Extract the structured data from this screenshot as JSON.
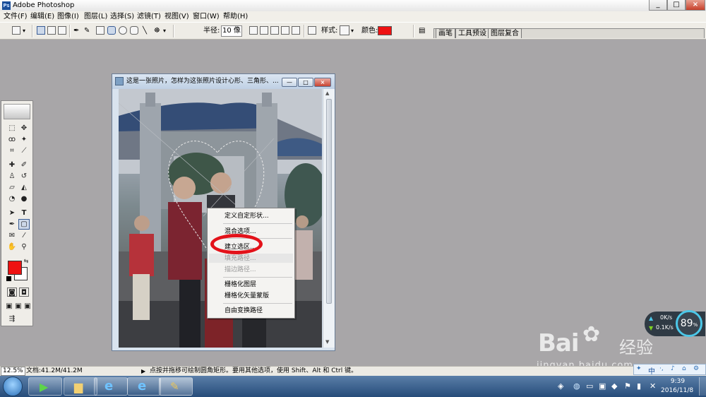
{
  "window": {
    "title": "Adobe Photoshop",
    "controls": [
      "_",
      "□",
      "×"
    ]
  },
  "menu": [
    "文件(F)",
    "编辑(E)",
    "图像(I)",
    "图层(L)",
    "选择(S)",
    "滤镜(T)",
    "视图(V)",
    "窗口(W)",
    "帮助(H)"
  ],
  "options_bar": {
    "radius_label": "半径:",
    "radius_value": "10 像",
    "style_label": "样式:",
    "color_label": "颜色:",
    "color_value": "#ee1111",
    "palette_tabs": [
      "画笔",
      "工具预设",
      "图层复合"
    ]
  },
  "document": {
    "title": "这是一张照片，怎样为这张照片设计心形、三角形、...",
    "controls": [
      "—",
      "□",
      "×"
    ]
  },
  "context_menu": {
    "items": [
      {
        "label": "定义自定形状...",
        "disabled": false
      },
      {
        "label": "混合选项...",
        "disabled": false
      },
      {
        "label": "建立选区...",
        "disabled": false
      },
      {
        "label": "填充路径...",
        "disabled": true
      },
      {
        "label": "描边路径...",
        "disabled": true
      },
      {
        "label": "栅格化图层",
        "disabled": false
      },
      {
        "label": "栅格化矢量蒙版",
        "disabled": false
      },
      {
        "label": "自由变换路径",
        "disabled": false
      }
    ]
  },
  "colors": {
    "foreground": "#ee1111",
    "background": "#ffffff",
    "highlight_ring": "#e3121a"
  },
  "status_bar": {
    "zoom": "12.5%",
    "doc_size": "文档:41.2M/41.2M",
    "hint": "点按并拖移可绘制圆角矩形。要用其他选项，使用 Shift、Alt 和 Ctrl 键。"
  },
  "net_widget": {
    "upload": "0K/s",
    "download": "0.1K/s",
    "percent": "89",
    "percent_unit": "%"
  },
  "watermark": {
    "brand": "Bai",
    "brand_cn": "经验",
    "url": "jingyan.baidu.com"
  },
  "tray": {
    "ime": "中",
    "time": "9:39",
    "date": "2016/11/8"
  }
}
